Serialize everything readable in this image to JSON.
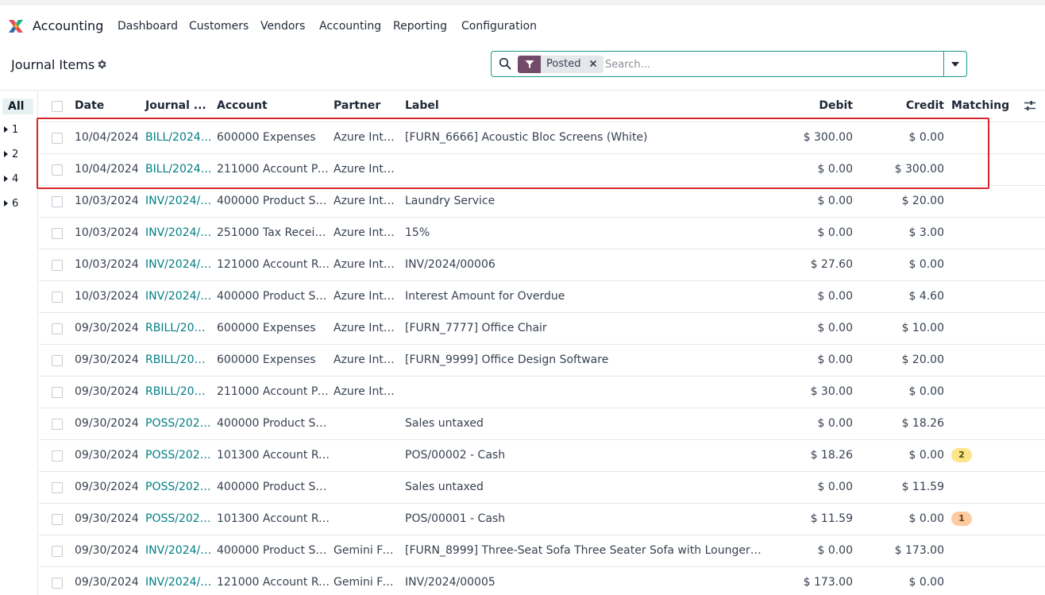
{
  "app": {
    "name": "Accounting",
    "menu": [
      "Dashboard",
      "Customers",
      "Vendors",
      "Accounting",
      "Reporting",
      "Configuration"
    ]
  },
  "control_panel": {
    "title": "Journal Items",
    "search": {
      "facet": "Posted",
      "placeholder": "Search..."
    }
  },
  "side_panel": {
    "all_label": "All",
    "groups": [
      "1",
      "2",
      "4",
      "6"
    ]
  },
  "table": {
    "headers": {
      "date": "Date",
      "journal": "Journal ...",
      "account": "Account",
      "partner": "Partner",
      "label": "Label",
      "debit": "Debit",
      "credit": "Credit",
      "matching": "Matching"
    },
    "rows": [
      {
        "date": "10/04/2024",
        "journal": "BILL/2024…",
        "account": "600000 Expenses",
        "partner": "Azure Inte…",
        "label": "[FURN_6666] Acoustic Bloc Screens (White)",
        "debit": "$ 300.00",
        "credit": "$ 0.00",
        "matching": ""
      },
      {
        "date": "10/04/2024",
        "journal": "BILL/2024…",
        "account": "211000 Account Pa…",
        "partner": "Azure Inte…",
        "label": "",
        "debit": "$ 0.00",
        "credit": "$ 300.00",
        "matching": ""
      },
      {
        "date": "10/03/2024",
        "journal": "INV/2024/…",
        "account": "400000 Product Sales",
        "partner": "Azure Inte…",
        "label": "Laundry Service",
        "debit": "$ 0.00",
        "credit": "$ 20.00",
        "matching": ""
      },
      {
        "date": "10/03/2024",
        "journal": "INV/2024/…",
        "account": "251000 Tax Received",
        "partner": "Azure Inte…",
        "label": "15%",
        "debit": "$ 0.00",
        "credit": "$ 3.00",
        "matching": ""
      },
      {
        "date": "10/03/2024",
        "journal": "INV/2024/…",
        "account": "121000 Account Re…",
        "partner": "Azure Inte…",
        "label": "INV/2024/00006",
        "debit": "$ 27.60",
        "credit": "$ 0.00",
        "matching": ""
      },
      {
        "date": "10/03/2024",
        "journal": "INV/2024/…",
        "account": "400000 Product Sales",
        "partner": "Azure Inte…",
        "label": "Interest Amount for Overdue",
        "debit": "$ 0.00",
        "credit": "$ 4.60",
        "matching": ""
      },
      {
        "date": "09/30/2024",
        "journal": "RBILL/202…",
        "account": "600000 Expenses",
        "partner": "Azure Inte…",
        "label": "[FURN_7777] Office Chair",
        "debit": "$ 0.00",
        "credit": "$ 10.00",
        "matching": ""
      },
      {
        "date": "09/30/2024",
        "journal": "RBILL/202…",
        "account": "600000 Expenses",
        "partner": "Azure Inte…",
        "label": "[FURN_9999] Office Design Software",
        "debit": "$ 0.00",
        "credit": "$ 20.00",
        "matching": ""
      },
      {
        "date": "09/30/2024",
        "journal": "RBILL/202…",
        "account": "211000 Account Pa…",
        "partner": "Azure Inte…",
        "label": "",
        "debit": "$ 30.00",
        "credit": "$ 0.00",
        "matching": ""
      },
      {
        "date": "09/30/2024",
        "journal": "POSS/202…",
        "account": "400000 Product Sales",
        "partner": "",
        "label": "Sales untaxed",
        "debit": "$ 0.00",
        "credit": "$ 18.26",
        "matching": ""
      },
      {
        "date": "09/30/2024",
        "journal": "POSS/202…",
        "account": "101300 Account Re…",
        "partner": "",
        "label": "POS/00002 - Cash",
        "debit": "$ 18.26",
        "credit": "$ 0.00",
        "matching": "2",
        "matching_color": "yellow"
      },
      {
        "date": "09/30/2024",
        "journal": "POSS/202…",
        "account": "400000 Product Sales",
        "partner": "",
        "label": "Sales untaxed",
        "debit": "$ 0.00",
        "credit": "$ 11.59",
        "matching": ""
      },
      {
        "date": "09/30/2024",
        "journal": "POSS/202…",
        "account": "101300 Account Re…",
        "partner": "",
        "label": "POS/00001 - Cash",
        "debit": "$ 11.59",
        "credit": "$ 0.00",
        "matching": "1",
        "matching_color": "orange"
      },
      {
        "date": "09/30/2024",
        "journal": "INV/2024/…",
        "account": "400000 Product Sales",
        "partner": "Gemini Fu…",
        "label": "[FURN_8999] Three-Seat Sofa Three Seater Sofa with Lounger in Ste…",
        "debit": "$ 0.00",
        "credit": "$ 173.00",
        "matching": ""
      },
      {
        "date": "09/30/2024",
        "journal": "INV/2024/…",
        "account": "121000 Account Re…",
        "partner": "Gemini Fu…",
        "label": "INV/2024/00005",
        "debit": "$ 173.00",
        "credit": "$ 0.00",
        "matching": ""
      }
    ]
  },
  "colors": {
    "brand": "#714b67",
    "link": "#017e84",
    "search_border": "#1a9a89",
    "highlight": "#d9262b"
  }
}
